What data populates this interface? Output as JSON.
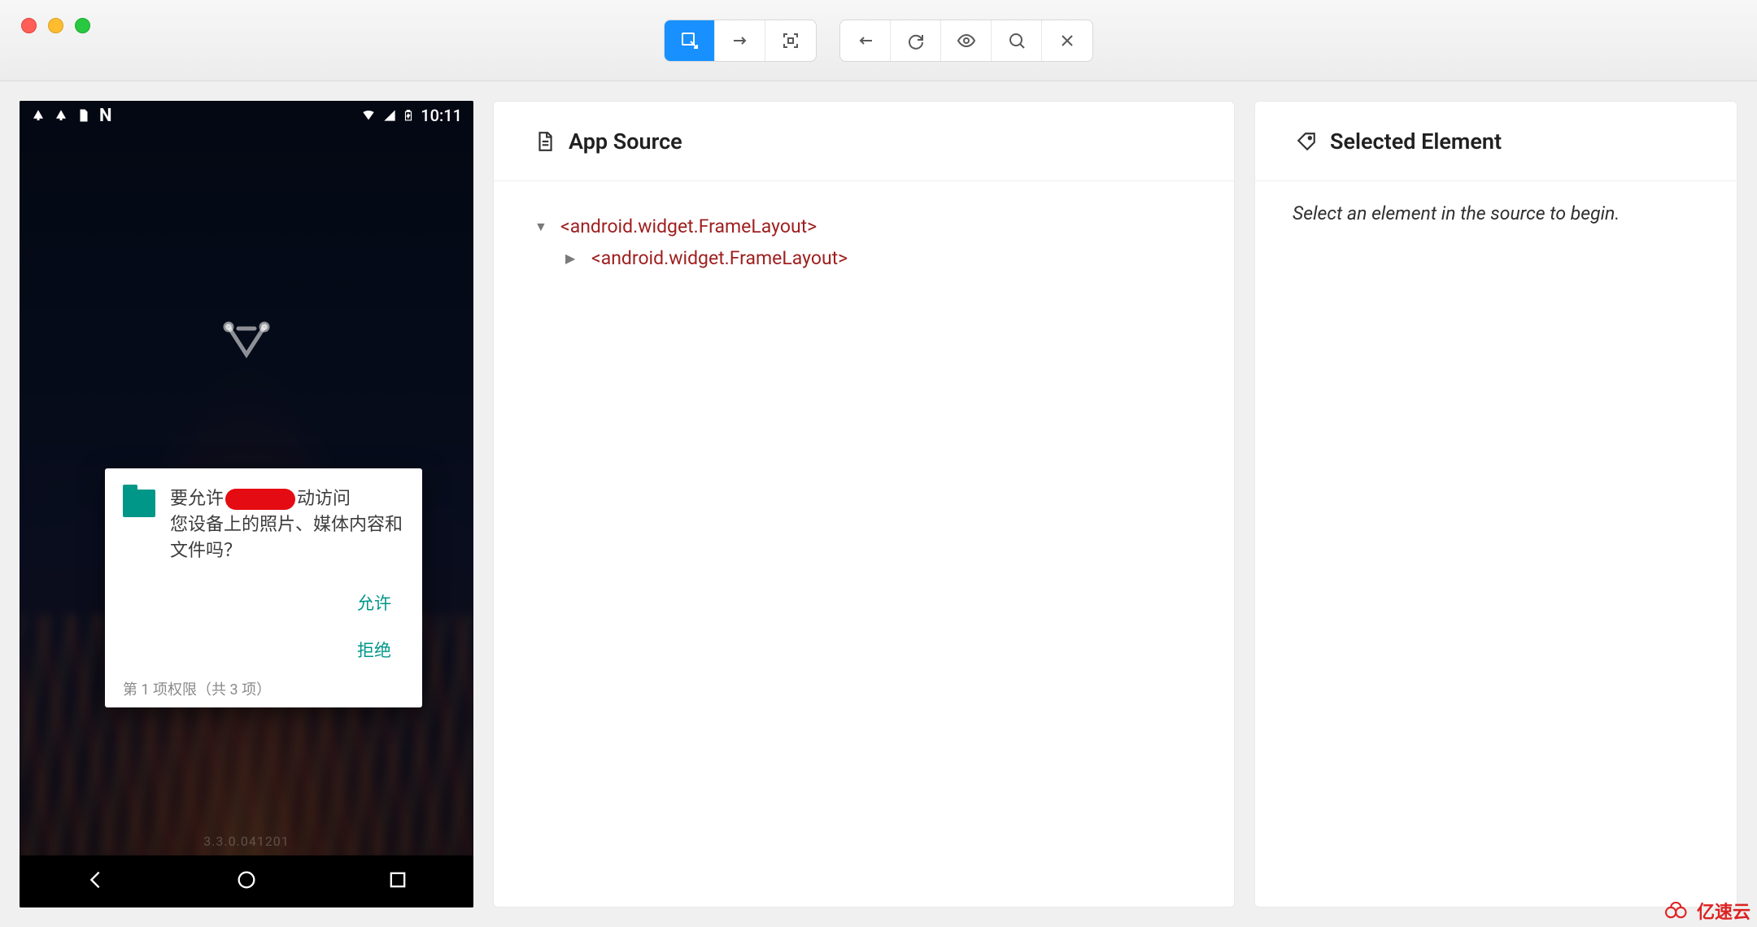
{
  "window": {
    "traffic": [
      "close",
      "minimize",
      "zoom"
    ]
  },
  "toolbar": {
    "group1": [
      "select-element",
      "swipe",
      "screenshot"
    ],
    "group2": [
      "back",
      "refresh",
      "toggle-record",
      "search",
      "quit"
    ]
  },
  "phone": {
    "time": "10:11",
    "dialog": {
      "text_pre": "要允许",
      "text_mid": "动访问",
      "text_line2": "您设备上的照片、媒体内容和文件吗？",
      "allow": "允许",
      "deny": "拒绝",
      "footer": "第 1 项权限（共 3 项）"
    },
    "watermark": "3.3.0.041201"
  },
  "source_panel": {
    "title": "App Source",
    "nodes": {
      "root": "<android.widget.FrameLayout>",
      "child": "<android.widget.FrameLayout>"
    }
  },
  "selected_panel": {
    "title": "Selected Element",
    "hint": "Select an element in the source to begin."
  },
  "brand": "亿速云"
}
